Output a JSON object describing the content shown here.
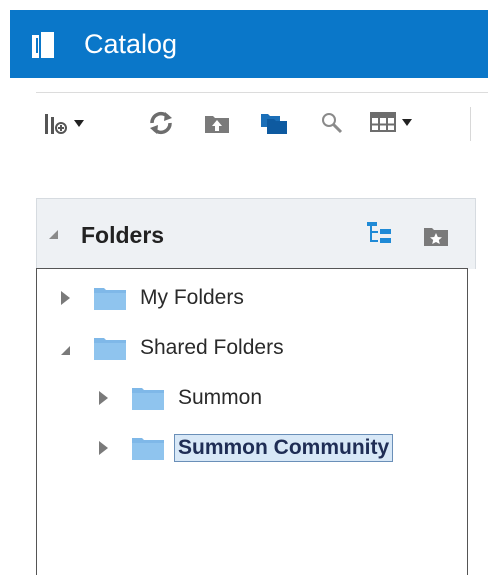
{
  "header": {
    "title": "Catalog",
    "background_color": "#0a77c9",
    "icon": "catalog-book-icon"
  },
  "toolbar": {
    "buttons": [
      {
        "name": "new-menu",
        "icon": "new-item-icon",
        "has_dropdown": true
      },
      {
        "name": "refresh",
        "icon": "refresh-icon",
        "has_dropdown": false
      },
      {
        "name": "upload",
        "icon": "folder-upload-icon",
        "has_dropdown": false
      },
      {
        "name": "copy",
        "icon": "folder-copy-icon",
        "has_dropdown": false
      },
      {
        "name": "search",
        "icon": "search-icon",
        "has_dropdown": false
      },
      {
        "name": "view",
        "icon": "view-grid-icon",
        "has_dropdown": true
      }
    ]
  },
  "folders_panel": {
    "title": "Folders",
    "tree": [
      {
        "label": "My Folders",
        "expanded": false,
        "selected": false,
        "level": 0
      },
      {
        "label": "Shared Folders",
        "expanded": true,
        "selected": false,
        "level": 0
      },
      {
        "label": "Summon",
        "expanded": false,
        "selected": false,
        "level": 1
      },
      {
        "label": "Summon Community",
        "expanded": false,
        "selected": true,
        "level": 1
      }
    ]
  },
  "colors": {
    "accent": "#0a77c9",
    "folder": "#7fb8e8",
    "selection_bg": "#d8e8f7",
    "selection_border": "#6a8fb8"
  }
}
